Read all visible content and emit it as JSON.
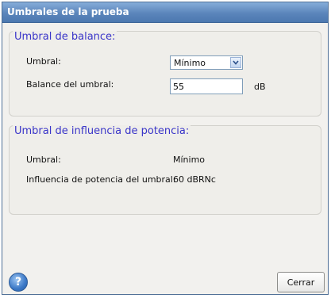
{
  "window": {
    "title": "Umbrales de la prueba"
  },
  "balance": {
    "title": "Umbral de balance:",
    "umbral_label": "Umbral:",
    "umbral_value": "Mínimo",
    "balance_label": "Balance del umbral:",
    "balance_value": "55",
    "unit": "dB"
  },
  "power": {
    "title": "Umbral de influencia de potencia:",
    "umbral_label": "Umbral:",
    "umbral_value": "Mínimo",
    "influence_label": "Influencia de potencia del umbral:",
    "influence_value": "60 dBRNc"
  },
  "footer": {
    "help_icon": "question-mark-icon",
    "help_glyph": "?",
    "close_label": "Cerrar"
  }
}
